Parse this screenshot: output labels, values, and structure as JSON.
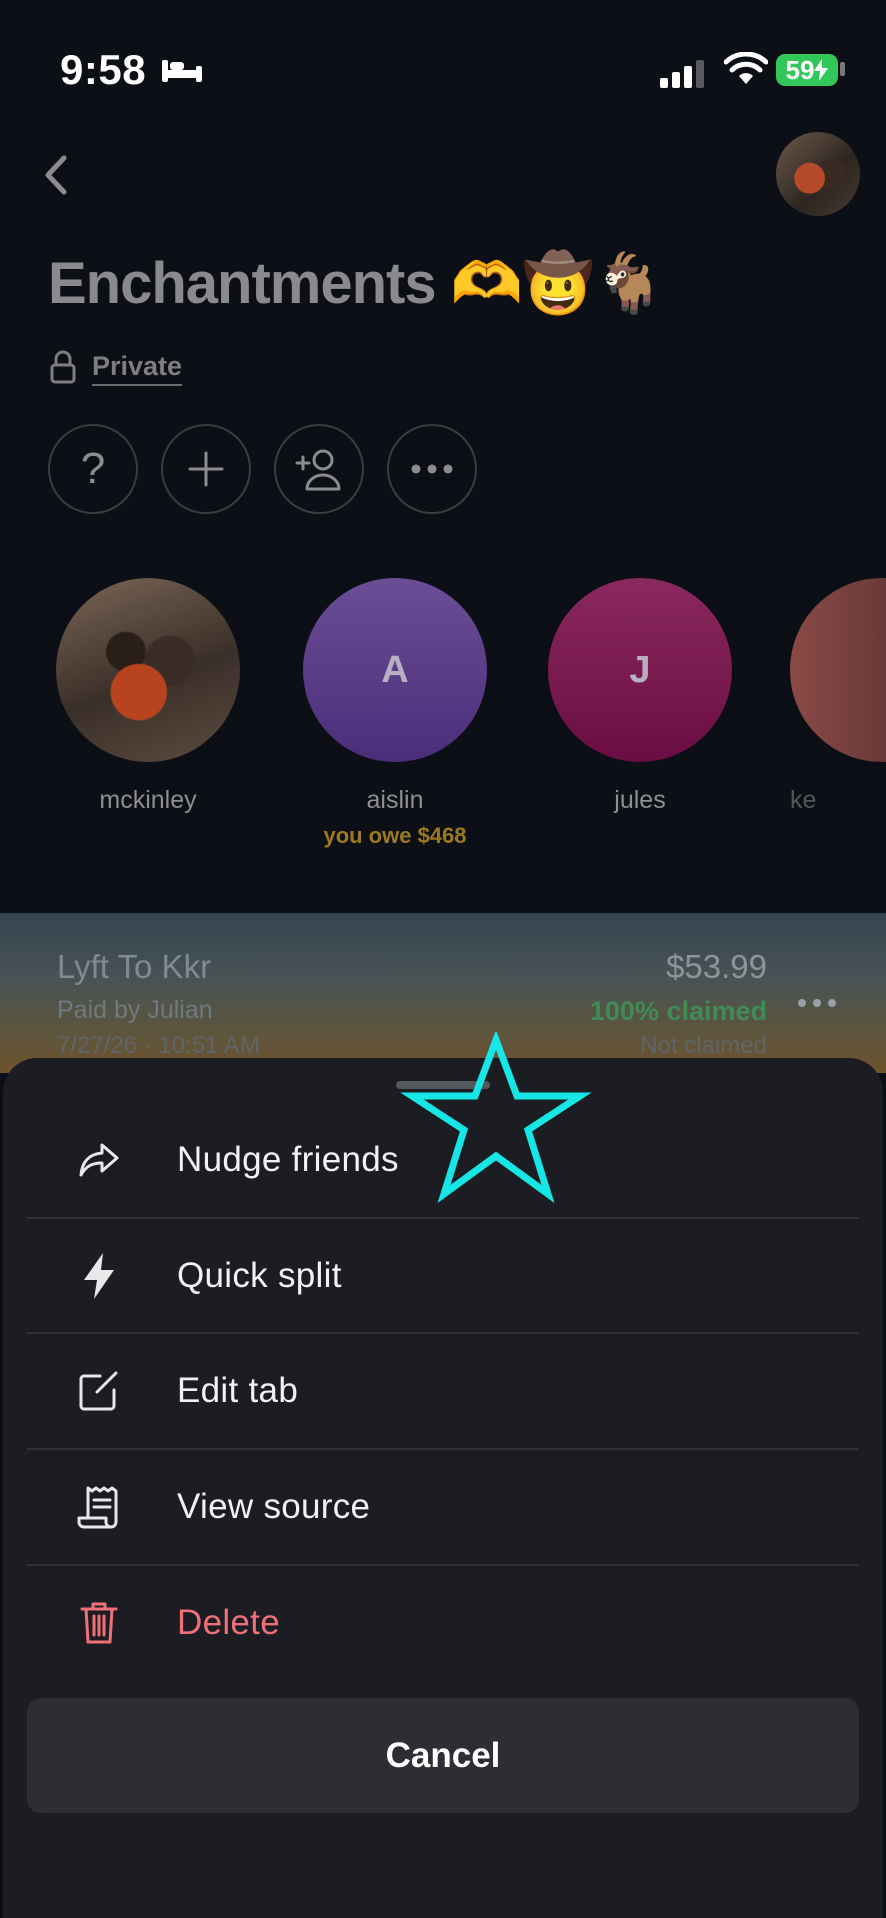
{
  "status_bar": {
    "time": "9:58",
    "battery": "59",
    "icons": [
      "bed-icon",
      "cellular-signal-icon",
      "wifi-icon",
      "battery-charging-icon"
    ]
  },
  "header": {
    "title": "Enchantments 🫶🤠🐐",
    "privacy": "Private",
    "actions": [
      "help",
      "add",
      "invite-member",
      "more"
    ],
    "help_glyph": "?"
  },
  "members": [
    {
      "name": "mckinley",
      "initial": "",
      "balance": ""
    },
    {
      "name": "aislin",
      "initial": "A",
      "balance": "you owe $468",
      "color": "#6a3fa0"
    },
    {
      "name": "jules",
      "initial": "J",
      "balance": "",
      "color": "#b0155e"
    },
    {
      "name": "ke",
      "initial": "",
      "balance": ""
    }
  ],
  "transaction": {
    "title": "Lyft To Kkr",
    "paid_by": "Paid by Julian",
    "date": "7/27/26 · 10:51 AM",
    "amount": "$53.99",
    "claimed": "100% claimed",
    "status": "Not claimed"
  },
  "sheet": {
    "items": [
      {
        "label": "Nudge friends",
        "icon": "share-arrow-icon"
      },
      {
        "label": "Quick split",
        "icon": "lightning-icon"
      },
      {
        "label": "Edit tab",
        "icon": "edit-icon"
      },
      {
        "label": "View source",
        "icon": "receipt-icon"
      },
      {
        "label": "Delete",
        "icon": "trash-icon",
        "color": "#f07078"
      }
    ],
    "cancel": "Cancel"
  },
  "annotation": {
    "shape": "star",
    "color": "#17e6e6"
  }
}
